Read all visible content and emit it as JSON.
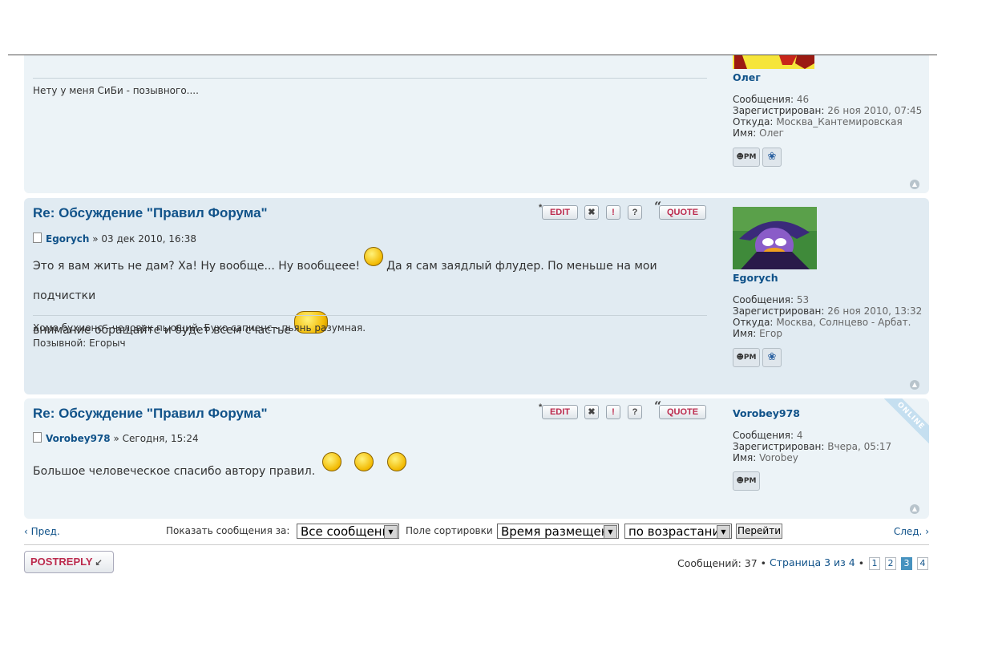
{
  "posts": [
    {
      "signature_line1": "Нету у меня СиБи - позывного....",
      "profile": {
        "username": "Олег",
        "messages_label": "Сообщения:",
        "messages": "46",
        "registered_label": "Зарегистрирован:",
        "registered": "26 ноя 2010, 07:45",
        "from_label": "Откуда:",
        "from": "Москва_Кантемировская",
        "name_label": "Имя:",
        "name": "Олег",
        "pm_label": "PM"
      }
    },
    {
      "title": "Re: Обсуждение \"Правил Форума\"",
      "author": "Egorych",
      "date": "» 03 дек 2010, 16:38",
      "body_part1": "Это я вам жить не дам? Ха! Ну вообще... Ну вообщеее!",
      "body_part2": "Да я сам заядлый флудер. По меньше на мои подчистки",
      "body_part3": "внимание обращайте и будет всем счастье",
      "signature_line1": "Хомо бухиенс - человек пьющий. Бухо сапиенс - пьянь разумная.",
      "signature_line2": "Позывной: Егорыч",
      "profile": {
        "username": "Egorych",
        "messages_label": "Сообщения:",
        "messages": "53",
        "registered_label": "Зарегистрирован:",
        "registered": "26 ноя 2010, 13:32",
        "from_label": "Откуда:",
        "from": "Москва, Солнцево - Арбат.",
        "name_label": "Имя:",
        "name": "Егор",
        "pm_label": "PM"
      }
    },
    {
      "title": "Re: Обсуждение \"Правил Форума\"",
      "author": "Vorobey978",
      "date": "» Сегодня, 15:24",
      "body_part1": "Большое человеческое спасибо автору правил.",
      "online_label": "ONLINE",
      "profile": {
        "username": "Vorobey978",
        "messages_label": "Сообщения:",
        "messages": "4",
        "registered_label": "Зарегистрирован:",
        "registered": "Вчера, 05:17",
        "name_label": "Имя:",
        "name": "Vorobey",
        "pm_label": "PM"
      }
    }
  ],
  "buttons": {
    "edit": "EDIT",
    "quote": "QUOTE",
    "delete_icon": "x-icon",
    "report_icon": "warning-icon",
    "info_icon": "question-icon"
  },
  "bottom_bar": {
    "prev": "Пред.",
    "show_label": "Показать сообщения за:",
    "show_value": "Все сообщени",
    "sort_label": "Поле сортировки",
    "sort_value": "Время размещен",
    "order_value": "по возрастани",
    "go_label": "Перейти",
    "next": "След."
  },
  "postreply_label": "POSTREPLY",
  "pagination": {
    "messages_text": "Сообщений: 37",
    "bullet": "•",
    "page_text": "Страница 3 из 4",
    "pages": [
      "1",
      "2",
      "3",
      "4"
    ],
    "current_page": "3"
  },
  "colors": {
    "post_bg_1": "#e1ebf2",
    "post_bg_2": "#ecf3f7",
    "link": "#105289",
    "button_text": "#bc2a4d",
    "current_page": "#4692bf"
  }
}
